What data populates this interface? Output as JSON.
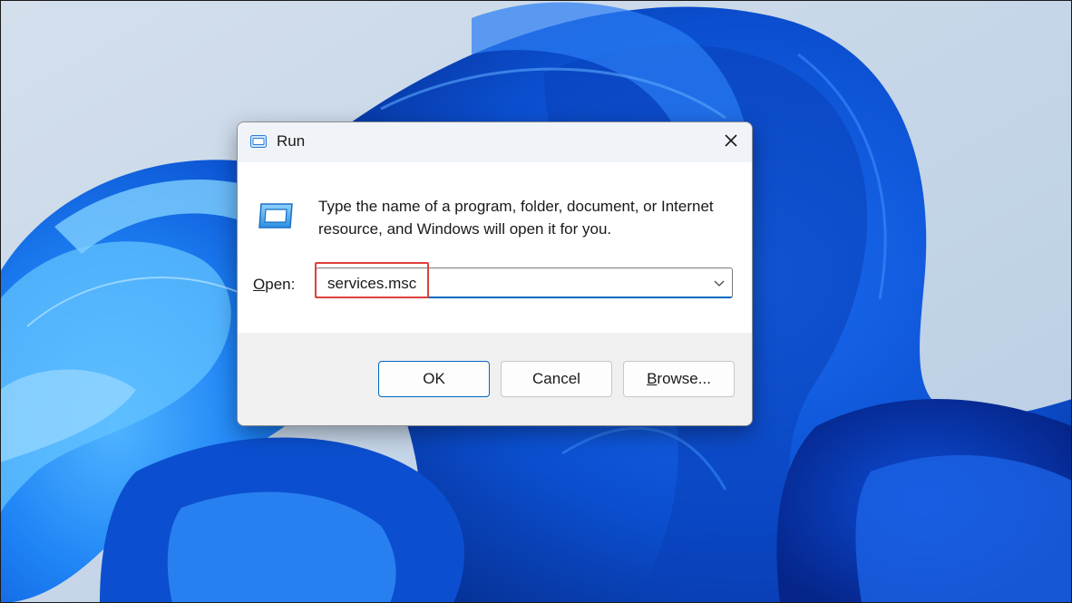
{
  "window": {
    "title": "Run",
    "title_icon": "run-app-icon",
    "close_icon": "close-icon"
  },
  "dialog": {
    "icon": "run-app-icon",
    "description": "Type the name of a program, folder, document, or Internet resource, and Windows will open it for you.",
    "open_label_accel": "O",
    "open_label_rest": "pen:",
    "open_value": "services.msc",
    "dropdown_icon": "chevron-down-icon"
  },
  "buttons": {
    "ok": "OK",
    "cancel": "Cancel",
    "browse_accel": "B",
    "browse_rest": "rowse..."
  },
  "colors": {
    "accent": "#0067c0",
    "highlight": "#e0413a",
    "wallpaper": "#0a4fd6"
  }
}
